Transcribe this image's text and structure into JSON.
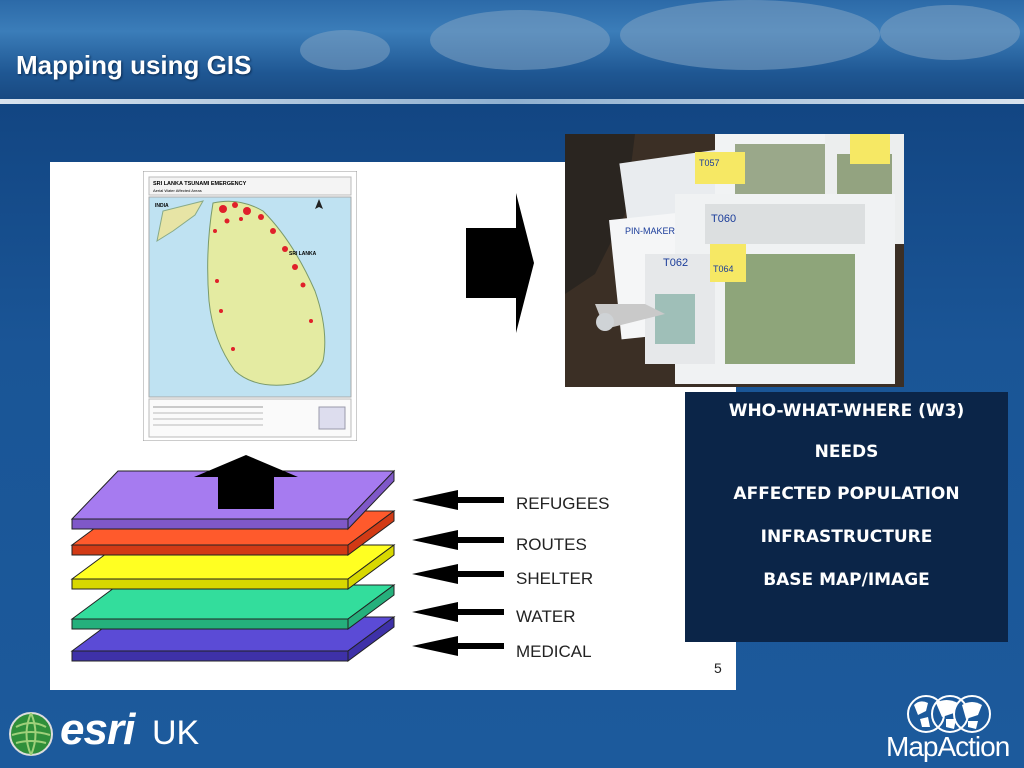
{
  "slide": {
    "title": "Mapping using GIS",
    "page_number": "5"
  },
  "map_thumbnail": {
    "heading": "SRI LANKA TSUNAMI EMERGENCY",
    "subheading": "Aerial Water Affected Areas",
    "country_label": "SRI LANKA",
    "neighbor_label": "INDIA"
  },
  "layers": [
    {
      "label": "REFUGEES",
      "color": "#a67bf0"
    },
    {
      "label": "ROUTES",
      "color": "#ff5a2c"
    },
    {
      "label": "SHELTER",
      "color": "#ffff22"
    },
    {
      "label": "WATER",
      "color": "#33dd9c"
    },
    {
      "label": "MEDICAL",
      "color": "#5b4bd6"
    }
  ],
  "w3": [
    "WHO-WHAT-WHERE (W3)",
    "NEEDS",
    "AFFECTED POPULATION",
    "INFRASTRUCTURE",
    "BASE MAP/IMAGE"
  ],
  "photo_notes": [
    "T057",
    "T060",
    "T062",
    "T064",
    "PIN-MAKER"
  ],
  "footer": {
    "esri": "esri",
    "uk": "UK",
    "mapaction": "MapAction"
  }
}
